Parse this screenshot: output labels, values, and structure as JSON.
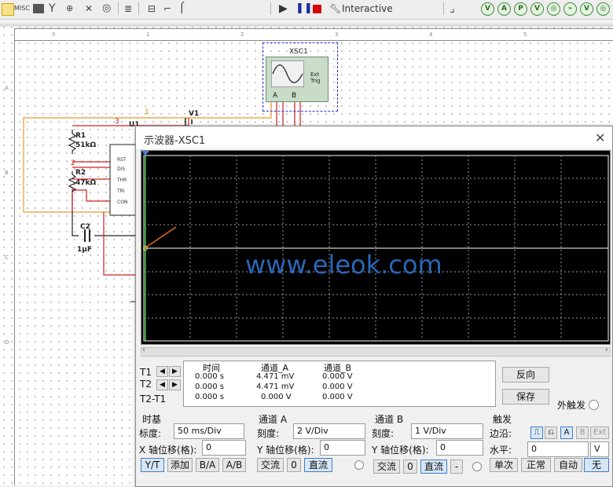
{
  "toolbar": {
    "misc_label": "MISC",
    "mode_label": "Interactive"
  },
  "schematic": {
    "xsc_label": "XSC1",
    "xsc_ext_trig": "Ext Trig",
    "v1_label": "V1",
    "u1_label": "U1",
    "r1_name": "R1",
    "r1_value": "51kΩ",
    "r2_name": "R2",
    "r2_value": "47kΩ",
    "c2_name": "C2",
    "c2_value": "1µF",
    "node_1": "1",
    "node_2": "2",
    "node_3": "3",
    "pins": [
      "RST",
      "DIS",
      "THR",
      "TRI",
      "CON"
    ]
  },
  "oscilloscope": {
    "title": "示波器-XSC1",
    "watermark": "www.eleok.com",
    "readout": {
      "headers": [
        "时间",
        "通道_A",
        "通道_B"
      ],
      "rows": [
        {
          "label": "T1",
          "time": "0.000 s",
          "a": "4.471 mV",
          "b": "0.000 V"
        },
        {
          "label": "T2",
          "time": "0.000 s",
          "a": "4.471 mV",
          "b": "0.000 V"
        },
        {
          "label": "T2-T1",
          "time": "0.000 s",
          "a": "0.000 V",
          "b": "0.000 V"
        }
      ]
    },
    "reverse_button": "反向",
    "save_button": "保存",
    "ext_trigger_label": "外触发",
    "timebase": {
      "title": "时基",
      "scale_label": "标度:",
      "scale_value": "50 ms/Div",
      "x_pos_label": "X 轴位移(格):",
      "x_pos_value": "0",
      "buttons": [
        "Y/T",
        "添加",
        "B/A",
        "A/B"
      ]
    },
    "channel_a": {
      "title": "通道 A",
      "scale_label": "刻度:",
      "scale_value": "2  V/Div",
      "y_pos_label": "Y 轴位移(格):",
      "y_pos_value": "0",
      "buttons": [
        "交流",
        "0",
        "直流"
      ]
    },
    "channel_b": {
      "title": "通道 B",
      "scale_label": "刻度:",
      "scale_value": "1  V/Div",
      "y_pos_label": "Y 轴位移(格):",
      "y_pos_value": "0",
      "buttons": [
        "交流",
        "0",
        "直流",
        "-"
      ]
    },
    "trigger": {
      "title": "触发",
      "edge_label": "边沿:",
      "edge_buttons": [
        "A",
        "B",
        "Ext"
      ],
      "level_label": "水平:",
      "level_value": "0",
      "level_unit": "V",
      "mode_buttons": [
        "单次",
        "正常",
        "自动",
        "无"
      ]
    }
  }
}
